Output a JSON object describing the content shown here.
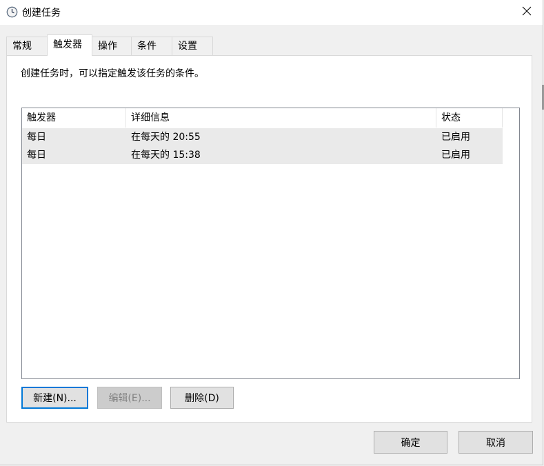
{
  "window": {
    "title": "创建任务"
  },
  "tabs": [
    {
      "label": "常规"
    },
    {
      "label": "触发器"
    },
    {
      "label": "操作"
    },
    {
      "label": "条件"
    },
    {
      "label": "设置"
    }
  ],
  "active_tab": "触发器",
  "description": "创建任务时，可以指定触发该任务的条件。",
  "triggers_table": {
    "columns": [
      "触发器",
      "详细信息",
      "状态"
    ],
    "rows": [
      {
        "trigger": "每日",
        "details": "在每天的 20:55",
        "status": "已启用"
      },
      {
        "trigger": "每日",
        "details": "在每天的 15:38",
        "status": "已启用"
      }
    ]
  },
  "buttons": {
    "new": "新建(N)...",
    "edit": "编辑(E)...",
    "delete": "删除(D)",
    "ok": "确定",
    "cancel": "取消"
  },
  "colors": {
    "accent": "#0078d7",
    "row_highlight": "#eaeaea",
    "window_bg": "#f0f0f0"
  }
}
